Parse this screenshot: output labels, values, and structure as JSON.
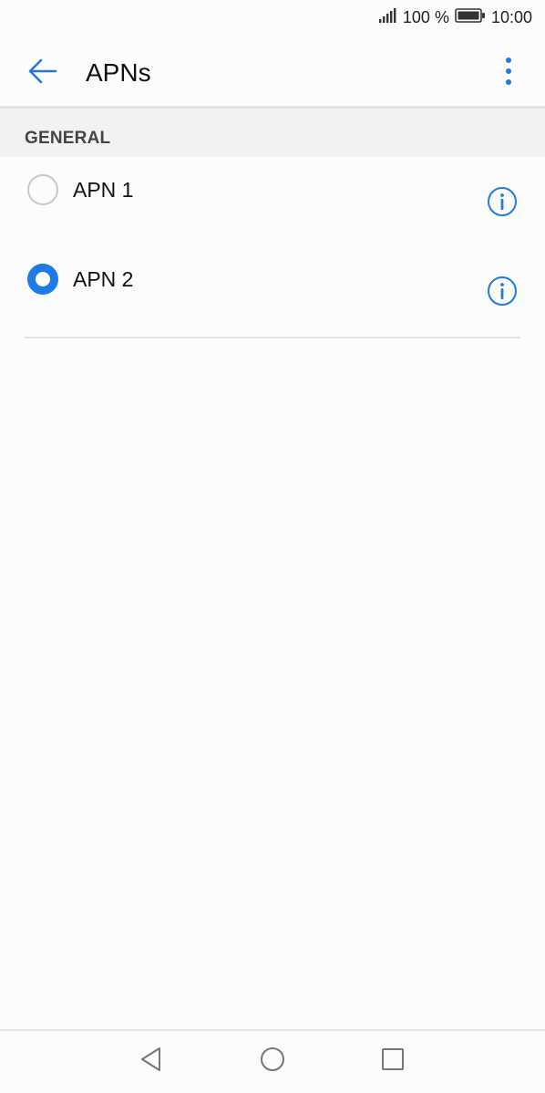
{
  "status_bar": {
    "battery_percent": "100 %",
    "time": "10:00",
    "signal_icon": "signal-bars-icon",
    "battery_icon": "battery-full-icon"
  },
  "app_bar": {
    "title": "APNs",
    "back_icon": "arrow-back-icon",
    "more_icon": "more-vert-icon"
  },
  "section": {
    "header": "GENERAL"
  },
  "apns": [
    {
      "label": "APN 1",
      "selected": false,
      "info_icon": "info-icon"
    },
    {
      "label": "APN 2",
      "selected": true,
      "info_icon": "info-icon"
    }
  ],
  "nav_bar": {
    "back_icon": "nav-back-triangle-icon",
    "home_icon": "nav-home-circle-icon",
    "recent_icon": "nav-recent-square-icon"
  },
  "colors": {
    "accent": "#1e7ae4",
    "background": "#fcfcfc",
    "section_bg": "#f2f2f2",
    "divider": "#e2e2e2"
  }
}
